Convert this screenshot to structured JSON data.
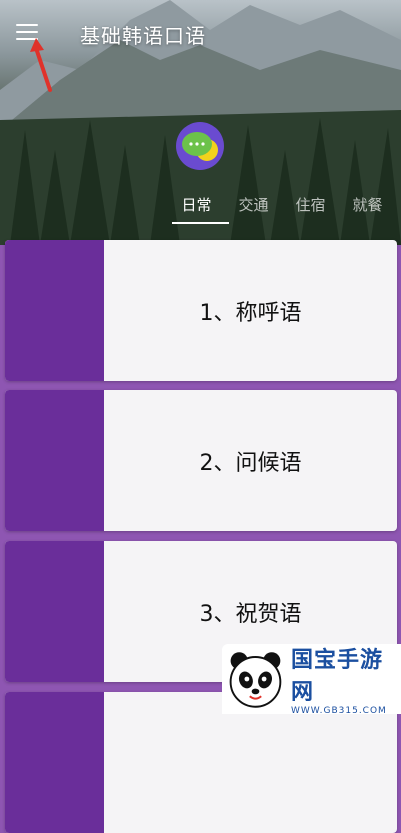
{
  "header": {
    "title": "基础韩语口语",
    "menu_icon": "hamburger-menu-icon"
  },
  "app_icon": "chat-bubble-icon",
  "tabs": [
    {
      "label": "日常",
      "active": true
    },
    {
      "label": "交通",
      "active": false
    },
    {
      "label": "住宿",
      "active": false
    },
    {
      "label": "就餐",
      "active": false
    }
  ],
  "cards": [
    {
      "label": "1、称呼语"
    },
    {
      "label": "2、问候语"
    },
    {
      "label": "3、祝贺语"
    }
  ],
  "watermark": {
    "brand": "国宝手游网",
    "url": "WWW.GB315.COM"
  },
  "colors": {
    "accent_purple": "#6a2e9a",
    "background_purple": "#8e56b2",
    "card_bg": "#f5f4f6"
  }
}
